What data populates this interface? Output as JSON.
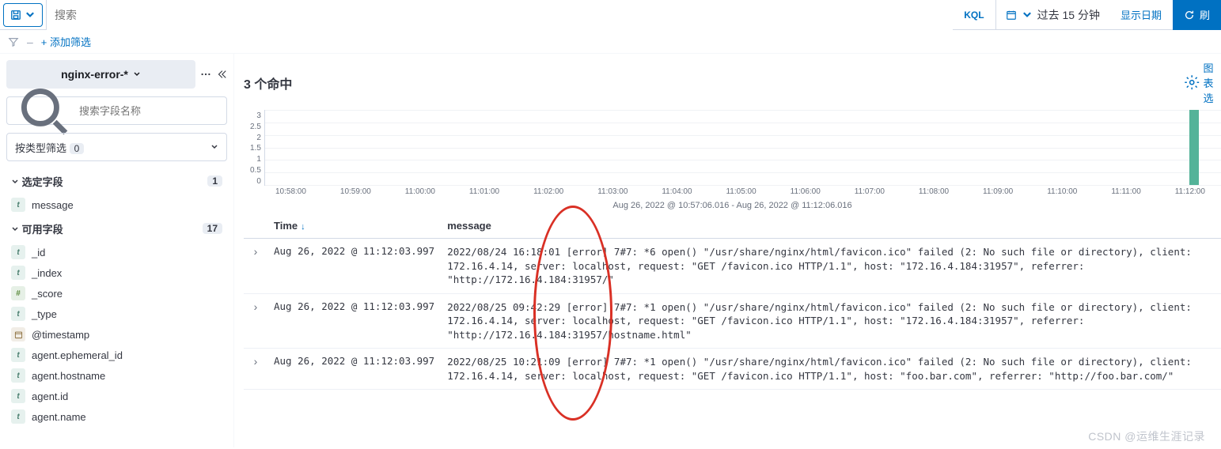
{
  "topbar": {
    "search_placeholder": "搜索",
    "kql": "KQL",
    "date_range": "过去 15 分钟",
    "show_dates": "显示日期",
    "refresh": "刷"
  },
  "filterbar": {
    "add_filter": "+ 添加筛选"
  },
  "sidebar": {
    "index_pattern": "nginx-error-*",
    "field_search_placeholder": "搜索字段名称",
    "type_filter_label": "按类型筛选",
    "type_filter_count": "0",
    "selected_header": "选定字段",
    "selected_count": "1",
    "selected_fields": [
      {
        "type": "t",
        "name": "message"
      }
    ],
    "available_header": "可用字段",
    "available_count": "17",
    "available_fields": [
      {
        "type": "t",
        "name": "_id"
      },
      {
        "type": "t",
        "name": "_index"
      },
      {
        "type": "n",
        "name": "_score"
      },
      {
        "type": "t",
        "name": "_type"
      },
      {
        "type": "d",
        "name": "@timestamp"
      },
      {
        "type": "t",
        "name": "agent.ephemeral_id"
      },
      {
        "type": "t",
        "name": "agent.hostname"
      },
      {
        "type": "t",
        "name": "agent.id"
      },
      {
        "type": "t",
        "name": "agent.name"
      }
    ]
  },
  "content": {
    "hits_count": "3",
    "hits_label": "个命中",
    "chart_options": "图表选",
    "chart_range": "Aug 26, 2022 @ 10:57:06.016 - Aug 26, 2022 @ 11:12:06.016",
    "columns": {
      "time": "Time",
      "message": "message"
    },
    "rows": [
      {
        "time": "Aug 26, 2022 @ 11:12:03.997",
        "message": "2022/08/24 16:18:01 [error] 7#7: *6 open() \"/usr/share/nginx/html/favicon.ico\" failed (2: No such file or directory), client: 172.16.4.14, server: localhost, request: \"GET /favicon.ico HTTP/1.1\", host: \"172.16.4.184:31957\", referrer: \"http://172.16.4.184:31957/\""
      },
      {
        "time": "Aug 26, 2022 @ 11:12:03.997",
        "message": "2022/08/25 09:42:29 [error] 7#7: *1 open() \"/usr/share/nginx/html/favicon.ico\" failed (2: No such file or directory), client: 172.16.4.14, server: localhost, request: \"GET /favicon.ico HTTP/1.1\", host: \"172.16.4.184:31957\", referrer: \"http://172.16.4.184:31957/hostname.html\""
      },
      {
        "time": "Aug 26, 2022 @ 11:12:03.997",
        "message": "2022/08/25 10:21:09 [error] 7#7: *1 open() \"/usr/share/nginx/html/favicon.ico\" failed (2: No such file or directory), client: 172.16.4.14, server: localhost, request: \"GET /favicon.ico HTTP/1.1\", host: \"foo.bar.com\", referrer: \"http://foo.bar.com/\""
      }
    ]
  },
  "chart_data": {
    "type": "bar",
    "categories": [
      "10:58:00",
      "10:59:00",
      "11:00:00",
      "11:01:00",
      "11:02:00",
      "11:03:00",
      "11:04:00",
      "11:05:00",
      "11:06:00",
      "11:07:00",
      "11:08:00",
      "11:09:00",
      "11:10:00",
      "11:11:00",
      "11:12:00"
    ],
    "values": [
      0,
      0,
      0,
      0,
      0,
      0,
      0,
      0,
      0,
      0,
      0,
      0,
      0,
      0,
      3
    ],
    "yticks": [
      "3",
      "2.5",
      "2",
      "1.5",
      "1",
      "0.5",
      "0"
    ],
    "ylim": [
      0,
      3
    ],
    "title": "",
    "xlabel": "",
    "ylabel": ""
  },
  "watermark": "CSDN @运维生涯记录"
}
